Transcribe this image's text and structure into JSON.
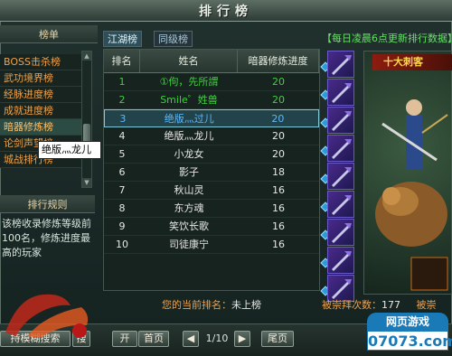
{
  "window": {
    "title": "排行榜"
  },
  "left_panel": {
    "heading": "榜单",
    "categories": [
      {
        "label": "BOSS击杀榜"
      },
      {
        "label": "武功境界榜"
      },
      {
        "label": "经脉进度榜"
      },
      {
        "label": "成就进度榜"
      },
      {
        "label": "暗器修炼榜"
      },
      {
        "label": "论剑声望榜"
      },
      {
        "label": "城战排行榜"
      }
    ],
    "rules_heading": "排行规则",
    "rules_text": "该榜收录修炼等级前100名，修炼进度最高的玩家"
  },
  "tooltip": {
    "text": "绝版灬龙儿"
  },
  "tabs": [
    {
      "label": "江湖榜"
    },
    {
      "label": "同级榜"
    }
  ],
  "banner": "【每日凌晨6点更新排行数据】",
  "table": {
    "headers": [
      "排名",
      "姓名",
      "暗器修炼进度"
    ],
    "rows": [
      {
        "rank": "1",
        "name": "①佝，先所謂",
        "progress": "20"
      },
      {
        "rank": "2",
        "name": "Smile゜姓兽",
        "progress": "20"
      },
      {
        "rank": "3",
        "name": "绝版灬过儿",
        "progress": "20"
      },
      {
        "rank": "4",
        "name": "绝版灬龙儿",
        "progress": "20"
      },
      {
        "rank": "5",
        "name": "小龙女",
        "progress": "20"
      },
      {
        "rank": "6",
        "name": "影子",
        "progress": "18"
      },
      {
        "rank": "7",
        "name": "秋山灵",
        "progress": "16"
      },
      {
        "rank": "8",
        "name": "东方魂",
        "progress": "16"
      },
      {
        "rank": "9",
        "name": "笑饮长歌",
        "progress": "16"
      },
      {
        "rank": "10",
        "name": "司徒康宁",
        "progress": "16"
      }
    ]
  },
  "my_rank": {
    "label": "您的当前排名：",
    "value": "未上榜"
  },
  "character": {
    "title": "十大刺客"
  },
  "worship": {
    "label": "被崇拜次数：",
    "value": "177",
    "extra": "被崇"
  },
  "pagination": {
    "fuzzy_search": "持模糊搜索",
    "search_stub": "搜",
    "next_stub": "开",
    "home": "首页",
    "prev": "◀",
    "page": "1/10",
    "next": "▶",
    "last": "尾页"
  },
  "logo": {
    "text": "傲剑"
  },
  "watermark": {
    "top": "网页游戏",
    "bottom": "07073.com"
  },
  "colors": {
    "accent_orange": "#f0a24a",
    "rank_green": "#3fd03f",
    "rank_blue": "#5ab8ff",
    "banner_green": "#66e266",
    "highlight_border": "#7fc8d8"
  }
}
